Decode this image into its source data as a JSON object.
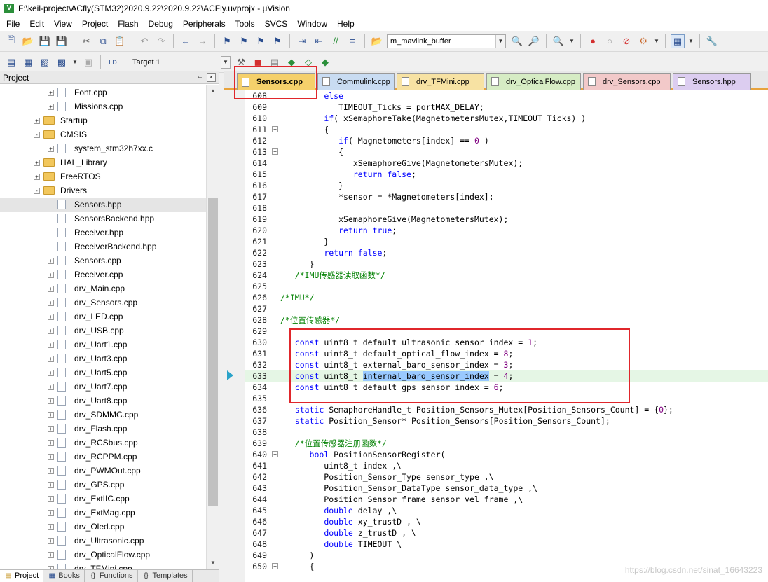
{
  "window": {
    "title": "F:\\keil-project\\ACfly(STM32)2020.9.22\\2020.9.22\\ACFly.uvprojx - µVision"
  },
  "menu": [
    "File",
    "Edit",
    "View",
    "Project",
    "Flash",
    "Debug",
    "Peripherals",
    "Tools",
    "SVCS",
    "Window",
    "Help"
  ],
  "toolbar": {
    "find_combo": "m_mavlink_buffer",
    "target_combo": "Target 1"
  },
  "project_panel": {
    "title": "Project",
    "pin": "←",
    "close": "×",
    "tree": [
      {
        "label": "Font.cpp",
        "type": "file",
        "expander": "+"
      },
      {
        "label": "Missions.cpp",
        "type": "file",
        "expander": "+"
      },
      {
        "label": "Startup",
        "type": "folder",
        "expander": "+"
      },
      {
        "label": "CMSIS",
        "type": "folder",
        "expander": "-"
      },
      {
        "label": "system_stm32h7xx.c",
        "type": "file",
        "expander": "+"
      },
      {
        "label": "HAL_Library",
        "type": "folder",
        "expander": "+"
      },
      {
        "label": "FreeRTOS",
        "type": "folder",
        "expander": "+"
      },
      {
        "label": "Drivers",
        "type": "folder",
        "expander": "-"
      },
      {
        "label": "Sensors.hpp",
        "type": "file",
        "expander": ""
      },
      {
        "label": "SensorsBackend.hpp",
        "type": "file",
        "expander": ""
      },
      {
        "label": "Receiver.hpp",
        "type": "file",
        "expander": ""
      },
      {
        "label": "ReceiverBackend.hpp",
        "type": "file",
        "expander": ""
      },
      {
        "label": "Sensors.cpp",
        "type": "file",
        "expander": "+"
      },
      {
        "label": "Receiver.cpp",
        "type": "file",
        "expander": "+"
      },
      {
        "label": "drv_Main.cpp",
        "type": "file",
        "expander": "+"
      },
      {
        "label": "drv_Sensors.cpp",
        "type": "file",
        "expander": "+"
      },
      {
        "label": "drv_LED.cpp",
        "type": "file",
        "expander": "+"
      },
      {
        "label": "drv_USB.cpp",
        "type": "file",
        "expander": "+"
      },
      {
        "label": "drv_Uart1.cpp",
        "type": "file",
        "expander": "+"
      },
      {
        "label": "drv_Uart3.cpp",
        "type": "file",
        "expander": "+"
      },
      {
        "label": "drv_Uart5.cpp",
        "type": "file",
        "expander": "+"
      },
      {
        "label": "drv_Uart7.cpp",
        "type": "file",
        "expander": "+"
      },
      {
        "label": "drv_Uart8.cpp",
        "type": "file",
        "expander": "+"
      },
      {
        "label": "drv_SDMMC.cpp",
        "type": "file",
        "expander": "+"
      },
      {
        "label": "drv_Flash.cpp",
        "type": "file",
        "expander": "+"
      },
      {
        "label": "drv_RCSbus.cpp",
        "type": "file",
        "expander": "+"
      },
      {
        "label": "drv_RCPPM.cpp",
        "type": "file",
        "expander": "+"
      },
      {
        "label": "drv_PWMOut.cpp",
        "type": "file",
        "expander": "+"
      },
      {
        "label": "drv_GPS.cpp",
        "type": "file",
        "expander": "+"
      },
      {
        "label": "drv_ExtIIC.cpp",
        "type": "file",
        "expander": "+"
      },
      {
        "label": "drv_ExtMag.cpp",
        "type": "file",
        "expander": "+"
      },
      {
        "label": "drv_Oled.cpp",
        "type": "file",
        "expander": "+"
      },
      {
        "label": "drv_Ultrasonic.cpp",
        "type": "file",
        "expander": "+"
      },
      {
        "label": "drv_OpticalFlow.cpp",
        "type": "file",
        "expander": "+"
      },
      {
        "label": "drv_TFMini.cpp",
        "type": "file",
        "expander": "+"
      }
    ],
    "bottom_tabs": [
      "Project",
      "Books",
      "Functions",
      "Templates"
    ]
  },
  "editor_tabs": [
    {
      "label": "Sensors.cpp",
      "color": "#f5d06b",
      "active": true
    },
    {
      "label": "Commulink.cpp",
      "color": "#c9dcf2",
      "active": false
    },
    {
      "label": "drv_TFMini.cpp",
      "color": "#f7e2a3",
      "active": false
    },
    {
      "label": "drv_OpticalFlow.cpp",
      "color": "#d6ecc4",
      "active": false
    },
    {
      "label": "drv_Sensors.cpp",
      "color": "#f2c9c9",
      "active": false
    },
    {
      "label": "Sensors.hpp",
      "color": "#dccdf0",
      "active": false
    }
  ],
  "code": {
    "lines": [
      {
        "n": "608",
        "html": "         <span class='kw'>else</span>"
      },
      {
        "n": "609",
        "html": "            TIMEOUT_Ticks = portMAX_DELAY;"
      },
      {
        "n": "610",
        "html": "         <span class='kw'>if</span>( xSemaphoreTake(MagnetometersMutex,TIMEOUT_Ticks) )"
      },
      {
        "n": "611",
        "html": "         {",
        "fold": "-"
      },
      {
        "n": "612",
        "html": "            <span class='kw'>if</span>( Magnetometers[index] == <span class='num'>0</span> )"
      },
      {
        "n": "613",
        "html": "            {",
        "fold": "-"
      },
      {
        "n": "614",
        "html": "               xSemaphoreGive(MagnetometersMutex);"
      },
      {
        "n": "615",
        "html": "               <span class='kw'>return</span> <span class='kw'>false</span>;"
      },
      {
        "n": "616",
        "html": "            }",
        "fold": "|"
      },
      {
        "n": "617",
        "html": "            *sensor = *Magnetometers[index];"
      },
      {
        "n": "618",
        "html": ""
      },
      {
        "n": "619",
        "html": "            xSemaphoreGive(MagnetometersMutex);"
      },
      {
        "n": "620",
        "html": "            <span class='kw'>return</span> <span class='kw'>true</span>;"
      },
      {
        "n": "621",
        "html": "         }",
        "fold": "|"
      },
      {
        "n": "622",
        "html": "         <span class='kw'>return</span> <span class='kw'>false</span>;"
      },
      {
        "n": "623",
        "html": "      }",
        "fold": "|"
      },
      {
        "n": "624",
        "html": "   <span class='cmt'>/*IMU传感器读取函数*/</span>"
      },
      {
        "n": "625",
        "html": ""
      },
      {
        "n": "626",
        "html": "<span class='cmt'>/*IMU*/</span>"
      },
      {
        "n": "627",
        "html": ""
      },
      {
        "n": "628",
        "html": "<span class='cmt'>/*位置传感器*/</span>"
      },
      {
        "n": "629",
        "html": ""
      },
      {
        "n": "630",
        "html": "   <span class='kw'>const</span> uint8_t default_ultrasonic_sensor_index = <span class='num'>1</span>;"
      },
      {
        "n": "631",
        "html": "   <span class='kw'>const</span> uint8_t default_optical_flow_index = <span class='num'>8</span>;"
      },
      {
        "n": "632",
        "html": "   <span class='kw'>const</span> uint8_t external_baro_sensor_index = <span class='num'>3</span>;"
      },
      {
        "n": "633",
        "html": "   <span class='kw'>const</span> uint8_t <span class='selw'>internal_baro_sensor_index</span> = <span class='num'>4</span>;",
        "hl": true
      },
      {
        "n": "634",
        "html": "   <span class='kw'>const</span> uint8_t default_gps_sensor_index = <span class='num'>6</span>;"
      },
      {
        "n": "635",
        "html": ""
      },
      {
        "n": "636",
        "html": "   <span class='kw'>static</span> SemaphoreHandle_t Position_Sensors_Mutex[Position_Sensors_Count] = {<span class='num'>0</span>};"
      },
      {
        "n": "637",
        "html": "   <span class='kw'>static</span> Position_Sensor* Position_Sensors[Position_Sensors_Count];"
      },
      {
        "n": "638",
        "html": ""
      },
      {
        "n": "639",
        "html": "   <span class='cmt'>/*位置传感器注册函数*/</span>"
      },
      {
        "n": "640",
        "html": "      <span class='kw'>bool</span> PositionSensorRegister(",
        "fold": "-"
      },
      {
        "n": "641",
        "html": "         uint8_t index ,\\"
      },
      {
        "n": "642",
        "html": "         Position_Sensor_Type sensor_type ,\\"
      },
      {
        "n": "643",
        "html": "         Position_Sensor_DataType sensor_data_type ,\\"
      },
      {
        "n": "644",
        "html": "         Position_Sensor_frame sensor_vel_frame ,\\"
      },
      {
        "n": "645",
        "html": "         <span class='kw'>double</span> delay ,\\"
      },
      {
        "n": "646",
        "html": "         <span class='kw'>double</span> xy_trustD , \\"
      },
      {
        "n": "647",
        "html": "         <span class='kw'>double</span> z_trustD , \\"
      },
      {
        "n": "648",
        "html": "         <span class='kw'>double</span> TIMEOUT \\"
      },
      {
        "n": "649",
        "html": "      )",
        "fold": "|"
      },
      {
        "n": "650",
        "html": "      {",
        "fold": "-"
      }
    ]
  },
  "watermark": "https://blog.csdn.net/sinat_16643223",
  "colors": {
    "annotation_red": "#e0262b",
    "tab_underline": "#e8a33c",
    "keyword": "#0000ff",
    "comment": "#008000"
  }
}
